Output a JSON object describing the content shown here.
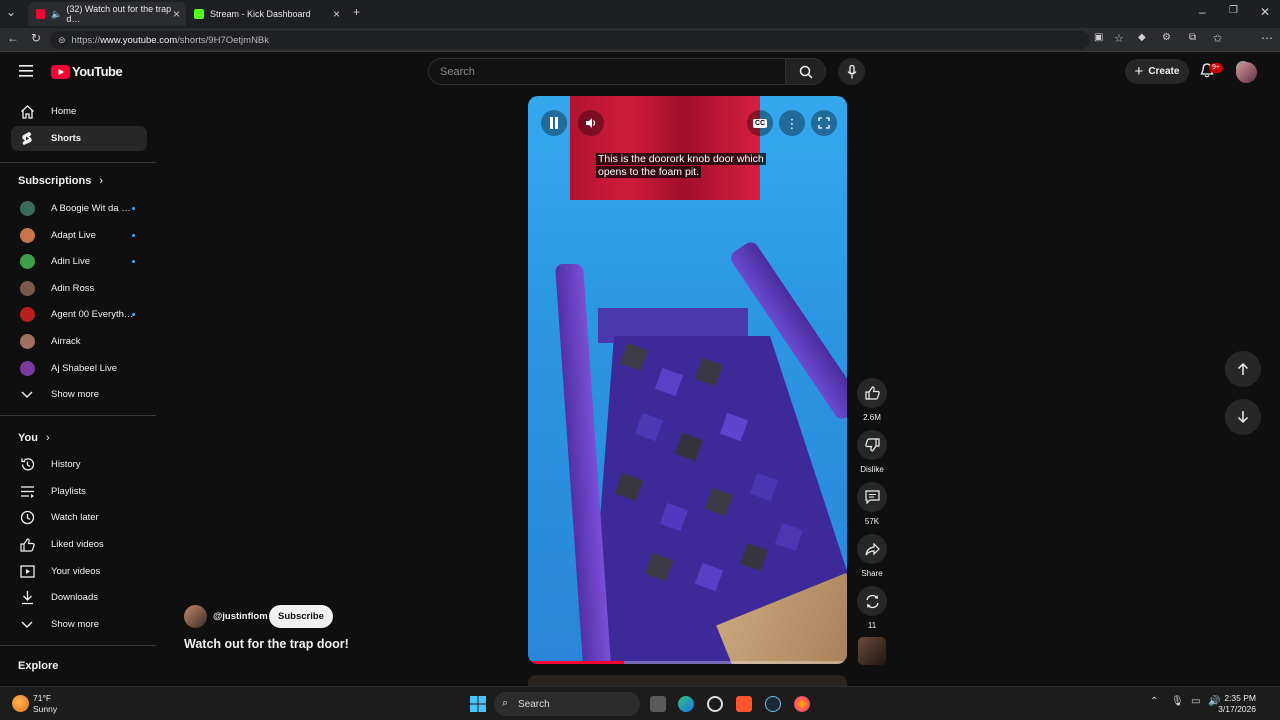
{
  "browser": {
    "tabs": [
      {
        "label": "(32) Watch out for the trap d…",
        "active": true
      },
      {
        "label": "Stream - Kick Dashboard",
        "active": false
      }
    ],
    "new_tab": "+",
    "url_prefix": "https://",
    "url_host": "www.youtube.com",
    "url_path": "/shorts/9H7OetjmNBk"
  },
  "header": {
    "logo_text": "YouTube",
    "search_placeholder": "Search",
    "create_label": "Create",
    "notification_badge": "9+"
  },
  "sidebar": {
    "main": [
      {
        "label": "Home",
        "icon": "home-icon"
      },
      {
        "label": "Shorts",
        "icon": "shorts-icon",
        "active": true
      }
    ],
    "subscriptions_title": "Subscriptions",
    "subscriptions": [
      {
        "label": "A Boogie Wit da …",
        "color": "#3a6b5a",
        "live": true
      },
      {
        "label": "Adapt Live",
        "color": "#c8744a",
        "live": true
      },
      {
        "label": "Adin Live",
        "color": "#3fa04c",
        "live": true
      },
      {
        "label": "Adin Ross",
        "color": "#7a5a4a",
        "live": false
      },
      {
        "label": "Agent 00 Everyth…",
        "color": "#b82020",
        "live": true
      },
      {
        "label": "Airrack",
        "color": "#a07060",
        "live": false
      },
      {
        "label": "Aj Shabeel Live",
        "color": "#7a3aa0",
        "live": false
      }
    ],
    "show_more": "Show more",
    "you_title": "You",
    "you_items": [
      {
        "label": "History",
        "icon": "history-icon"
      },
      {
        "label": "Playlists",
        "icon": "playlists-icon"
      },
      {
        "label": "Watch later",
        "icon": "clock-icon"
      },
      {
        "label": "Liked videos",
        "icon": "thumb-up-icon"
      },
      {
        "label": "Your videos",
        "icon": "play-icon"
      },
      {
        "label": "Downloads",
        "icon": "download-icon"
      }
    ],
    "show_more_2": "Show more",
    "explore_title": "Explore"
  },
  "short": {
    "caption_line1": "This is the doorork knob door which",
    "caption_line2": "opens to the foam pit.",
    "progress": 0.3,
    "channel": "@justinflom",
    "subscribe": "Subscribe",
    "title": "Watch out for the trap door!"
  },
  "actions": {
    "likes": "2.6M",
    "dislike": "Dislike",
    "comments": "57K",
    "share": "Share",
    "remix": "11"
  },
  "taskbar": {
    "temp": "71°F",
    "weather": "Sunny",
    "search": "Search",
    "time": "2:35 PM",
    "date": "3/17/2026"
  }
}
